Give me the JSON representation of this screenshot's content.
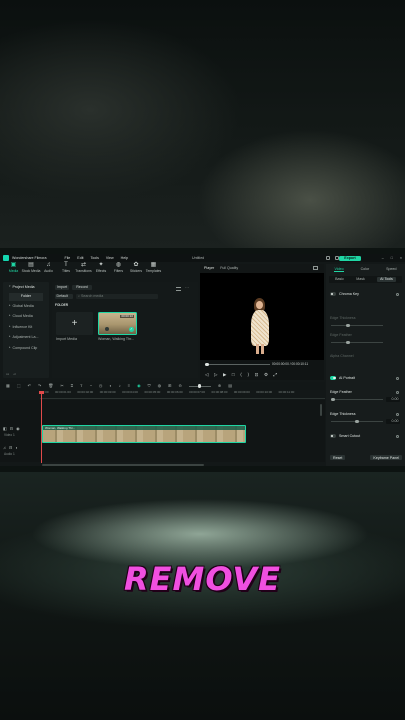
{
  "overlay": {
    "caption": "REMOVE"
  },
  "app": {
    "name": "Wondershare Filmora",
    "menu": [
      "File",
      "Edit",
      "Tools",
      "View",
      "Help"
    ],
    "project": "Untitled",
    "export_label": "Export",
    "window_controls": [
      "–",
      "□",
      "×"
    ]
  },
  "toolbar": {
    "tools": [
      {
        "label": "Media",
        "icon": "media-icon",
        "glyph": "▣",
        "active": true
      },
      {
        "label": "Stock Media",
        "icon": "stock-media-icon",
        "glyph": "▤"
      },
      {
        "label": "Audio",
        "icon": "audio-icon",
        "glyph": "♫"
      },
      {
        "label": "Titles",
        "icon": "titles-icon",
        "glyph": "T"
      },
      {
        "label": "Transitions",
        "icon": "transitions-icon",
        "glyph": "⇄"
      },
      {
        "label": "Effects",
        "icon": "effects-icon",
        "glyph": "✦"
      },
      {
        "label": "Filters",
        "icon": "filters-icon",
        "glyph": "◍"
      },
      {
        "label": "Stickers",
        "icon": "stickers-icon",
        "glyph": "✿"
      },
      {
        "label": "Templates",
        "icon": "templates-icon",
        "glyph": "▦"
      }
    ]
  },
  "sidebar": {
    "items": [
      {
        "label": "Project Media",
        "head": true
      },
      {
        "label": "Folder",
        "selected": true
      },
      {
        "label": "Global Media"
      },
      {
        "label": "Cloud Media"
      },
      {
        "label": "Influence Kit"
      },
      {
        "label": "Adjustment La..."
      },
      {
        "label": "Compound Clip"
      }
    ]
  },
  "media": {
    "import_label": "Import",
    "record_label": "Record",
    "sort_value": "Default",
    "search_placeholder": "Search media",
    "folder_label": "FOLDER",
    "import_tile_label": "Import Media",
    "clip": {
      "name": "Woman, Walking Thr...",
      "duration": "00:00:10"
    }
  },
  "player": {
    "tab": "Player",
    "quality": "Full Quality",
    "current_time": "00:00:00:00",
    "total_time": "00:00:10:11",
    "controls": [
      "◁",
      "▷",
      "▶",
      "□",
      "⟨",
      "⟩",
      "⊡",
      "⚙",
      "⤢"
    ]
  },
  "properties": {
    "tabs": [
      "Video",
      "Color",
      "Speed"
    ],
    "active_tab": "Video",
    "subtabs": [
      "Basic",
      "Mask",
      "AI Tools"
    ],
    "chroma_key": "Chroma Key",
    "dim_rows": [
      "Edge Thickness",
      "Edge Feather",
      "Alpha Channel"
    ],
    "ai_portrait": "AI Portrait",
    "edge_feather": "Edge Feather",
    "edge_feather_value": "0.00",
    "edge_thickness": "Edge Thickness",
    "edge_thickness_value": "0.00",
    "smart_cutout": "Smart Cutout",
    "reset_label": "Reset",
    "keyframe_label": "Keyframe Panel"
  },
  "timeline": {
    "ruler": [
      "00:00",
      "00:00:01:00",
      "00:00:02:00",
      "00:00:03:00",
      "00:00:04:00",
      "00:00:05:00",
      "00:00:06:00",
      "00:00:07:00",
      "00:00:08:00",
      "00:00:09:00",
      "00:00:10:00",
      "00:00:11:00"
    ],
    "video_track": "Video 1",
    "audio_track": "Audio 1",
    "clip_label": "Woman, Walking Thr..."
  },
  "colors": {
    "accent": "#1fd6a4",
    "caption": "#f04fe0",
    "playhead": "#e04a4a"
  }
}
